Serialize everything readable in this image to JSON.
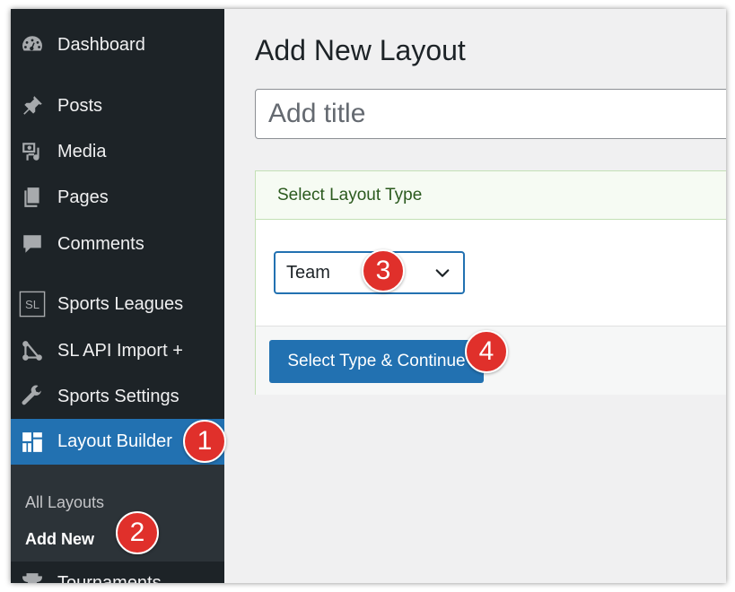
{
  "sidebar": {
    "items": [
      {
        "label": "Dashboard",
        "icon": "dashboard-icon"
      },
      {
        "label": "Posts",
        "icon": "pin-icon"
      },
      {
        "label": "Media",
        "icon": "media-icon"
      },
      {
        "label": "Pages",
        "icon": "pages-icon"
      },
      {
        "label": "Comments",
        "icon": "comment-icon"
      },
      {
        "label": "Sports Leagues",
        "icon": "sl-icon",
        "icon_text": "SL"
      },
      {
        "label": "SL API Import +",
        "icon": "api-import-icon"
      },
      {
        "label": "Sports Settings",
        "icon": "wrench-icon"
      },
      {
        "label": "Layout Builder",
        "icon": "layout-builder-icon",
        "active": true
      },
      {
        "label": "Tournaments",
        "icon": "trophy-icon"
      }
    ],
    "submenu": [
      {
        "label": "All Layouts"
      },
      {
        "label": "Add New",
        "current": true
      }
    ]
  },
  "main": {
    "page_title": "Add New Layout",
    "title_placeholder": "Add title",
    "panel": {
      "header": "Select Layout Type",
      "select_value": "Team",
      "button_label": "Select Type & Continue"
    }
  },
  "badges": [
    "1",
    "2",
    "3",
    "4"
  ],
  "colors": {
    "sidebar_bg": "#1d2327",
    "accent": "#2271b1",
    "badge": "#e0302b",
    "panel_border": "#c3e0b5"
  }
}
